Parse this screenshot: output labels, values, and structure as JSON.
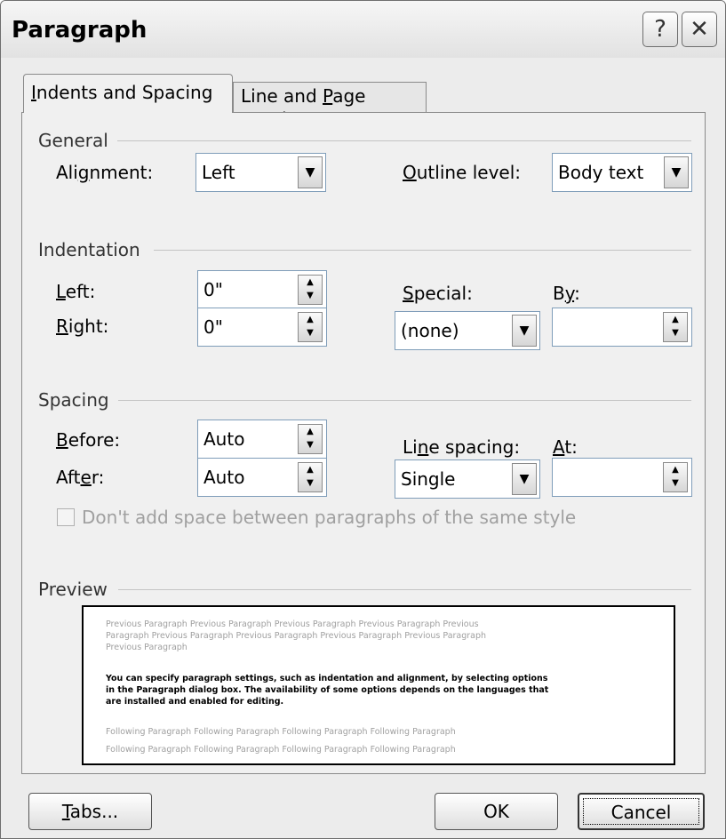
{
  "window": {
    "title": "Paragraph",
    "help_glyph": "?",
    "close_glyph": "✕"
  },
  "tabs": {
    "indents": {
      "pre": "",
      "mn": "I",
      "post": "ndents and Spacing"
    },
    "breaks": {
      "pre": "Line and ",
      "mn": "P",
      "post": "age Breaks"
    }
  },
  "general": {
    "heading": "General",
    "alignment": {
      "pre": "Ali",
      "mn": "g",
      "post": "nment:",
      "value": "Left"
    },
    "outline_level": {
      "pre": "",
      "mn": "O",
      "post": "utline level:",
      "value": "Body text"
    }
  },
  "indentation": {
    "heading": "Indentation",
    "left": {
      "pre": "",
      "mn": "L",
      "post": "eft:",
      "value": "0\""
    },
    "right": {
      "pre": "",
      "mn": "R",
      "post": "ight:",
      "value": "0\""
    },
    "special": {
      "pre": "",
      "mn": "S",
      "post": "pecial:",
      "value": "(none)"
    },
    "by": {
      "pre": "B",
      "mn": "y",
      "post": ":",
      "value": ""
    }
  },
  "spacing": {
    "heading": "Spacing",
    "before": {
      "pre": "",
      "mn": "B",
      "post": "efore:",
      "value": "Auto"
    },
    "after": {
      "pre": "Aft",
      "mn": "e",
      "post": "r:",
      "value": "Auto"
    },
    "line_spacing": {
      "pre": "Li",
      "mn": "n",
      "post": "e spacing:",
      "value": "Single"
    },
    "at": {
      "pre": "",
      "mn": "A",
      "post": "t:",
      "value": ""
    },
    "dont_add_space": {
      "label": "Don't add space between paragraphs of the same style",
      "checked": false
    }
  },
  "preview": {
    "heading": "Preview",
    "previous_lines": [
      "Previous Paragraph Previous Paragraph Previous Paragraph Previous Paragraph Previous",
      "Paragraph Previous Paragraph Previous Paragraph Previous Paragraph Previous Paragraph",
      "Previous Paragraph"
    ],
    "sample_lines": [
      "You can specify paragraph settings, such as indentation and alignment, by selecting options",
      "in the Paragraph dialog box. The availability of some options depends on the languages that",
      "are installed and enabled for editing."
    ],
    "following_lines": [
      "Following Paragraph Following Paragraph Following Paragraph Following Paragraph",
      "Following Paragraph Following Paragraph Following Paragraph Following Paragraph"
    ]
  },
  "buttons": {
    "tabs": {
      "pre": "",
      "mn": "T",
      "post": "abs..."
    },
    "ok": "OK",
    "cancel": "Cancel"
  },
  "icons": {
    "dropdown": "chevron-down-icon",
    "spinner": "spinner-arrows-icon",
    "help": "help-icon",
    "close": "close-icon"
  }
}
